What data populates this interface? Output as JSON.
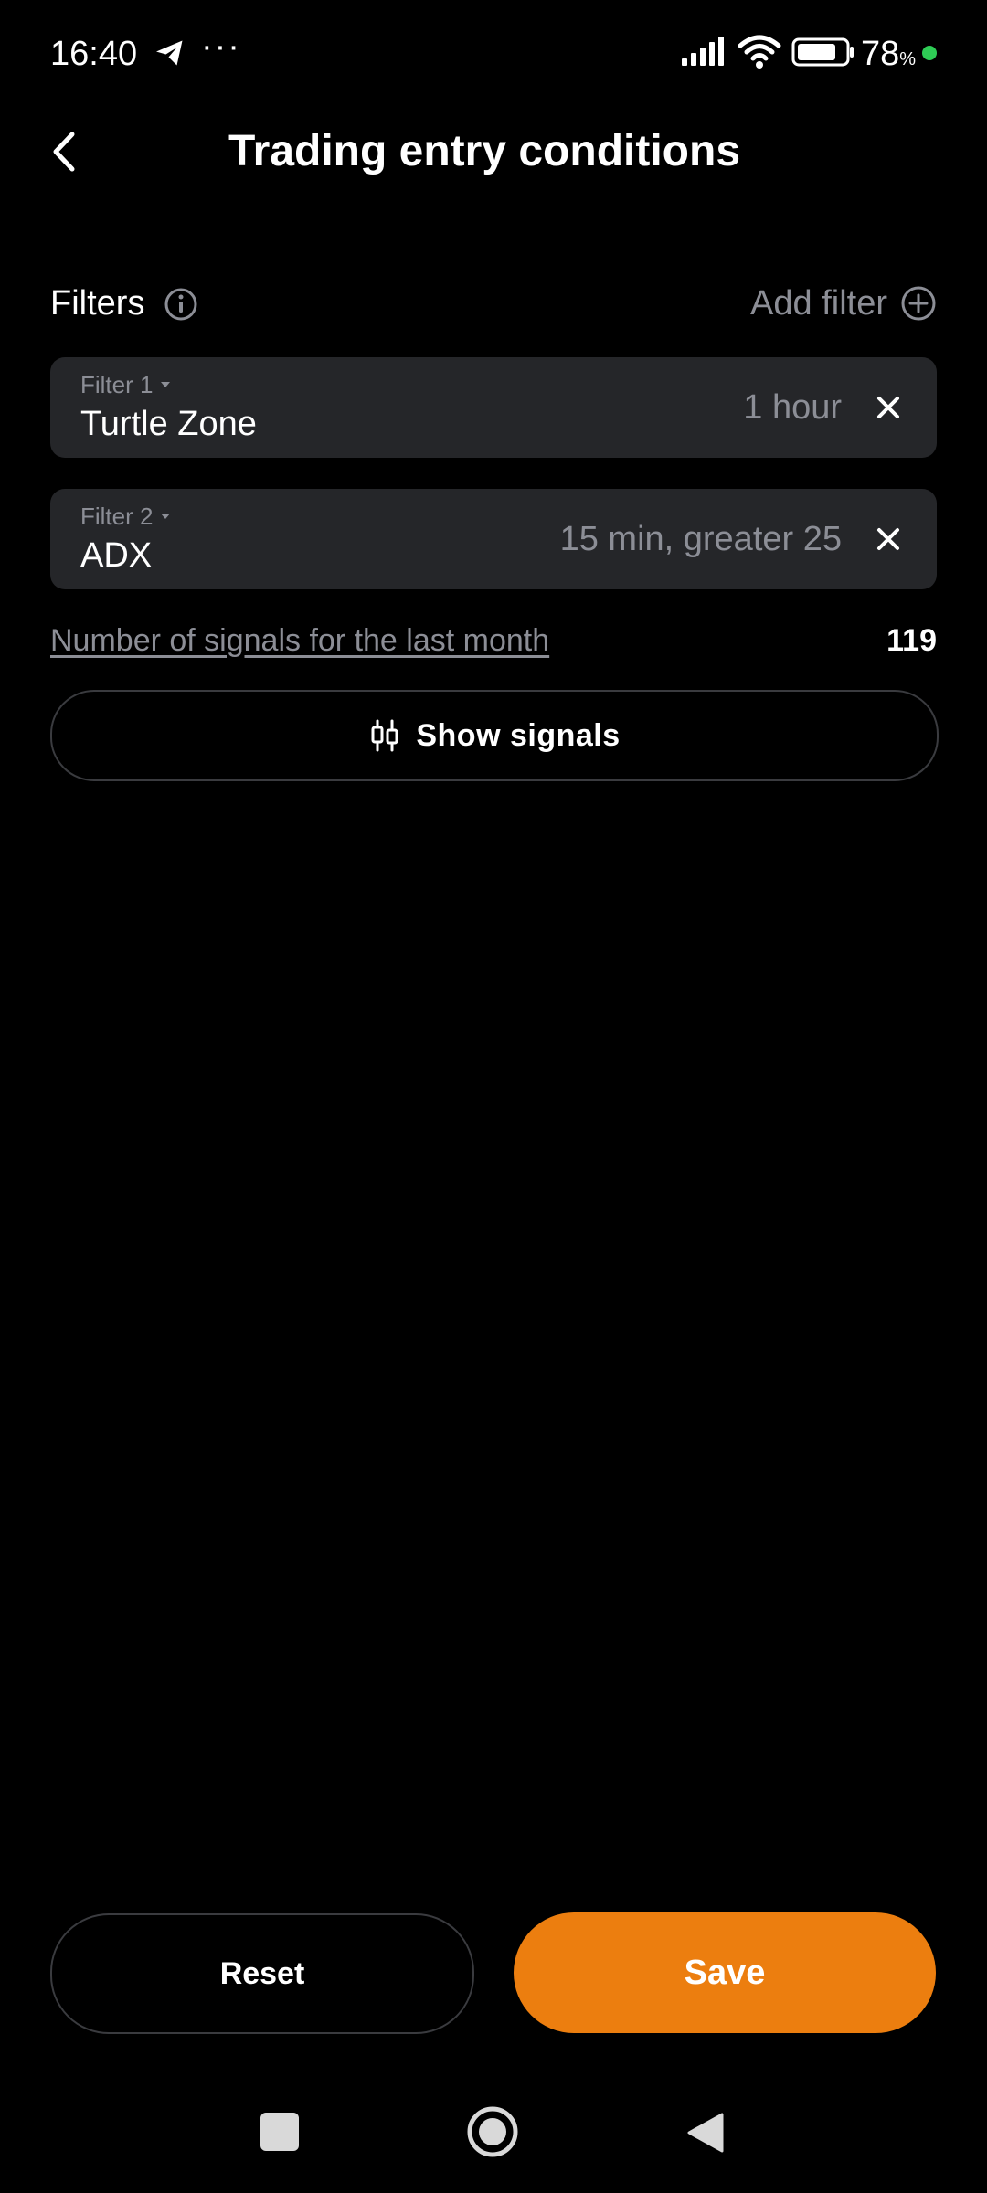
{
  "status_bar": {
    "time": "16:40",
    "notification_icons": [
      "telegram-icon",
      "more-dots-icon"
    ],
    "more_dots": "···",
    "battery_percent": "78",
    "battery_unit": "%",
    "indicator_color": "#2ecc55"
  },
  "header": {
    "title": "Trading entry conditions",
    "back_icon": "chevron-left-icon"
  },
  "filters_section": {
    "label": "Filters",
    "info_icon": "info-icon",
    "add_filter_label": "Add filter",
    "add_icon": "plus-circle-icon"
  },
  "filters": [
    {
      "caption": "Filter 1",
      "name": "Turtle Zone",
      "value": "1 hour"
    },
    {
      "caption": "Filter 2",
      "name": "ADX",
      "value": "15 min, greater 25"
    }
  ],
  "signals": {
    "label": "Number of signals for the last month",
    "count": "119",
    "show_button_label": "Show signals",
    "show_button_icon": "candlestick-icon"
  },
  "actions": {
    "reset_label": "Reset",
    "save_label": "Save",
    "save_color": "#ec7e0f"
  },
  "nav_bar": {
    "icons": [
      "recents-square-icon",
      "home-circle-icon",
      "back-triangle-icon"
    ]
  },
  "theme": {
    "background": "#000000",
    "card_background": "#252629",
    "muted_text": "#8c8e96",
    "accent": "#ec7e0f"
  }
}
